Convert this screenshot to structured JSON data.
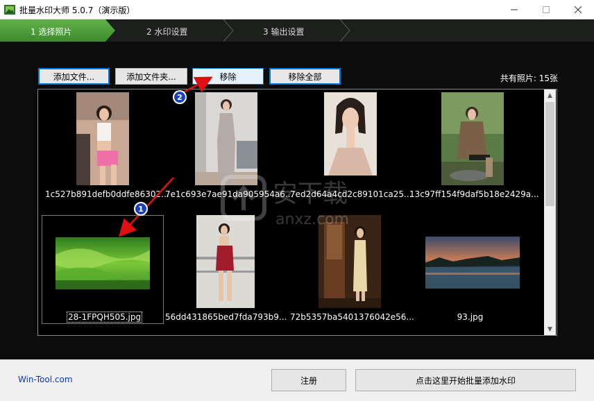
{
  "window": {
    "title": "批量水印大师 5.0.7（演示版）",
    "minimize_icon": "minimize-icon",
    "maximize_icon": "maximize-icon",
    "close_icon": "close-icon"
  },
  "wizard": {
    "steps": [
      {
        "label": "1 选择照片",
        "active": true
      },
      {
        "label": "2 水印设置",
        "active": false
      },
      {
        "label": "3 输出设置",
        "active": false
      }
    ]
  },
  "toolbar": {
    "add_files": "添加文件...",
    "add_folder": "添加文件夹...",
    "remove": "移除",
    "remove_all": "移除全部",
    "photo_count": "共有照片: 15张"
  },
  "thumbnails": [
    {
      "caption": "1c527b891defb0ddfe86302...",
      "subject": "woman-gym-photo",
      "selected": false
    },
    {
      "caption": "7e1c693e7ae91da905954a6...",
      "subject": "woman-gown-photo",
      "selected": false
    },
    {
      "caption": "7ed2d64a4cd2c89101ca25...",
      "subject": "woman-portrait-photo",
      "selected": false
    },
    {
      "caption": "13c97ff154f9daf5b18e2429a...",
      "subject": "woman-outdoor-photo",
      "selected": false
    },
    {
      "caption": "28-1FPQH505.jpg",
      "subject": "green-hills-photo",
      "selected": true
    },
    {
      "caption": "56dd431865bed7fda793b9...",
      "subject": "woman-red-dress-photo",
      "selected": false
    },
    {
      "caption": "72b5357ba5401376042e56...",
      "subject": "woman-qipao-photo",
      "selected": false
    },
    {
      "caption": "93.jpg",
      "subject": "lake-sunset-photo",
      "selected": false
    }
  ],
  "annotations": {
    "badge_1": "1",
    "badge_2": "2",
    "arrow_color": "#e01010",
    "watermark_text": "安下载",
    "watermark_url": "anxz.com"
  },
  "footer": {
    "site": "Win-Tool.com",
    "register": "注册",
    "start": "点击这里开始批量添加水印"
  },
  "colors": {
    "active_step": "#4b9c3a",
    "step_bg": "#1d1f1d",
    "panel_bg": "#0c0c0c",
    "focus_border": "#0078d7"
  }
}
